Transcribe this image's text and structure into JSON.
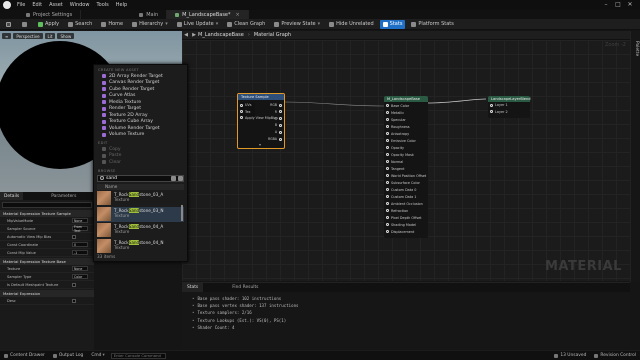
{
  "menubar": {
    "items": [
      "File",
      "Edit",
      "Asset",
      "Window",
      "Tools",
      "Help"
    ],
    "window_controls": [
      "–",
      "□",
      "✕"
    ]
  },
  "doc_tabs": [
    {
      "label": "Project Settings",
      "active": false
    },
    {
      "label": "Main",
      "active": false
    },
    {
      "label": "M_LandscapeBase*",
      "active": true
    }
  ],
  "toolbar": {
    "buttons": [
      "Apply",
      "Search",
      "Home",
      "Hierarchy",
      "Live Update",
      "Clean Graph",
      "Preview State",
      "Hide Unrelated",
      "Stats",
      "Platform Stats"
    ]
  },
  "viewport": {
    "buttons": [
      "Perspective",
      "Lit",
      "Show"
    ]
  },
  "context_menu": {
    "section_create": "CREATE NEW ASSET",
    "create_items": [
      "2D Array Render Target",
      "Canvas Render Target",
      "Cube Render Target",
      "Curve Atlas",
      "Media Texture",
      "Render Target",
      "Texture 2D Array",
      "Texture Cube Array",
      "Volume Render Target",
      "Volume Texture"
    ],
    "section_edit": "EDIT",
    "edit_items": [
      "Copy",
      "Paste",
      "Clear"
    ],
    "section_browse": "BROWSE",
    "search_value": "sand",
    "column_header": "Name",
    "assets": [
      {
        "prefix": "T_Rock",
        "highlight": "Sand",
        "suffix": "stone_03_A",
        "type": "Texture",
        "selected": false
      },
      {
        "prefix": "T_Rock",
        "highlight": "Sand",
        "suffix": "stone_03_N",
        "type": "Texture",
        "selected": true
      },
      {
        "prefix": "T_Rock",
        "highlight": "Sand",
        "suffix": "stone_04_A",
        "type": "Texture",
        "selected": false
      },
      {
        "prefix": "T_Rock",
        "highlight": "Sand",
        "suffix": "stone_04_N",
        "type": "Texture",
        "selected": false
      }
    ],
    "footer": "33 items"
  },
  "details": {
    "tabs": [
      "Details",
      "Parameters"
    ],
    "categories": [
      {
        "label": "Material Expression Texture Sample",
        "props": [
          {
            "label": "MipValueMode",
            "value": "None"
          },
          {
            "label": "Sampler Source",
            "value": "From Text"
          },
          {
            "label": "Automatic View Mip Bias",
            "value": ""
          },
          {
            "label": "Const Coordinate",
            "value": "0"
          },
          {
            "label": "Const Mip Value",
            "value": "-1"
          }
        ]
      },
      {
        "label": "Material Expression Texture Base",
        "props": [
          {
            "label": "Texture",
            "value": "None"
          },
          {
            "label": "Sampler Type",
            "value": "Color"
          },
          {
            "label": "Is Default Meshpaint Texture",
            "value": ""
          }
        ]
      },
      {
        "label": "Material Expression",
        "props": [
          {
            "label": "Desc",
            "value": ""
          }
        ]
      }
    ]
  },
  "graph": {
    "breadcrumb": [
      "M_LandscapeBase",
      "Material Graph"
    ],
    "zoom_label": "Zoom -2",
    "watermark": "MATERIAL",
    "palette_label": "Palette",
    "texture_node": {
      "title": "Texture Sample",
      "inputs": [
        "UVs",
        "Tex",
        "Apply View MipBias"
      ],
      "outputs": [
        "RGB",
        "R",
        "G",
        "B",
        "A",
        "RGBA"
      ]
    },
    "result_node": {
      "title": "M_LandscapeBase",
      "pins": [
        "Base Color",
        "Metallic",
        "Specular",
        "Roughness",
        "Anisotropy",
        "Emissive Color",
        "Opacity",
        "Opacity Mask",
        "Normal",
        "Tangent",
        "World Position Offset",
        "Subsurface Color",
        "Custom Data 0",
        "Custom Data 1",
        "Ambient Occlusion",
        "Refraction",
        "Pixel Depth Offset",
        "Shading Model",
        "Displacement"
      ]
    },
    "layer_node": {
      "title": "LandscapeLayerBlend",
      "pins": [
        "Layer 1",
        "Layer 2"
      ]
    }
  },
  "stats": {
    "tabs": [
      "Stats",
      "Find Results"
    ],
    "lines": [
      "Base pass shader: 102 instructions",
      "Base pass vertex shader: 137 instructions",
      "Texture samplers: 2/16",
      "Texture Lookups (Est.): VS(0), PS(1)",
      "Shader Count: 4"
    ]
  },
  "statusbar": {
    "content_drawer": "Content Drawer",
    "output_log": "Output Log",
    "cmd": "Cmd",
    "cmd_placeholder": "Enter Console Command",
    "unsaved": "13 Unsaved",
    "revision": "Revision Control"
  }
}
